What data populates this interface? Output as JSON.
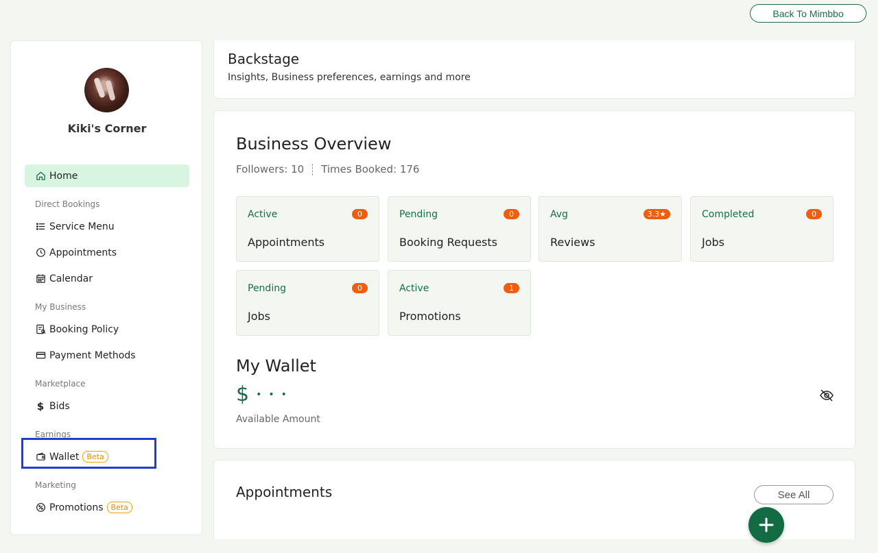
{
  "header": {
    "back_label": "Back To Mimbbo"
  },
  "sidebar": {
    "business_name": "Kiki's Corner",
    "home_label": "Home",
    "sections": {
      "direct_bookings": "Direct Bookings",
      "my_business": "My Business",
      "marketplace": "Marketplace",
      "earnings": "Earnings",
      "marketing": "Marketing"
    },
    "items": {
      "service_menu": "Service Menu",
      "appointments": "Appointments",
      "calendar": "Calendar",
      "booking_policy": "Booking Policy",
      "payment_methods": "Payment Methods",
      "bids": "Bids",
      "wallet": "Wallet",
      "promotions": "Promotions"
    },
    "beta_label": "Beta"
  },
  "backstage": {
    "title": "Backstage",
    "subtitle": "Insights, Business preferences, earnings and more"
  },
  "overview": {
    "title": "Business Overview",
    "followers": "Followers: 10",
    "times_booked": "Times Booked: 176",
    "cards": [
      {
        "top": "Active",
        "badge": "0",
        "bottom": "Appointments"
      },
      {
        "top": "Pending",
        "badge": "0",
        "bottom": "Booking Requests"
      },
      {
        "top": "Avg",
        "badge": "3.3★",
        "bottom": "Reviews"
      },
      {
        "top": "Completed",
        "badge": "0",
        "bottom": "Jobs"
      },
      {
        "top": "Pending",
        "badge": "0",
        "bottom": "Jobs"
      },
      {
        "top": "Active",
        "badge": "1",
        "bottom": "Promotions"
      }
    ]
  },
  "wallet": {
    "title": "My Wallet",
    "currency": "$",
    "masked": "•••",
    "label": "Available Amount"
  },
  "appointments": {
    "title": "Appointments",
    "see_all": "See All"
  },
  "colors": {
    "brand_green": "#1b6b4a",
    "active_nav_bg": "#d8f5e1",
    "badge_orange": "#f25c0f",
    "beta_amber": "#e09000",
    "highlight_blue": "#1c3fcf"
  }
}
